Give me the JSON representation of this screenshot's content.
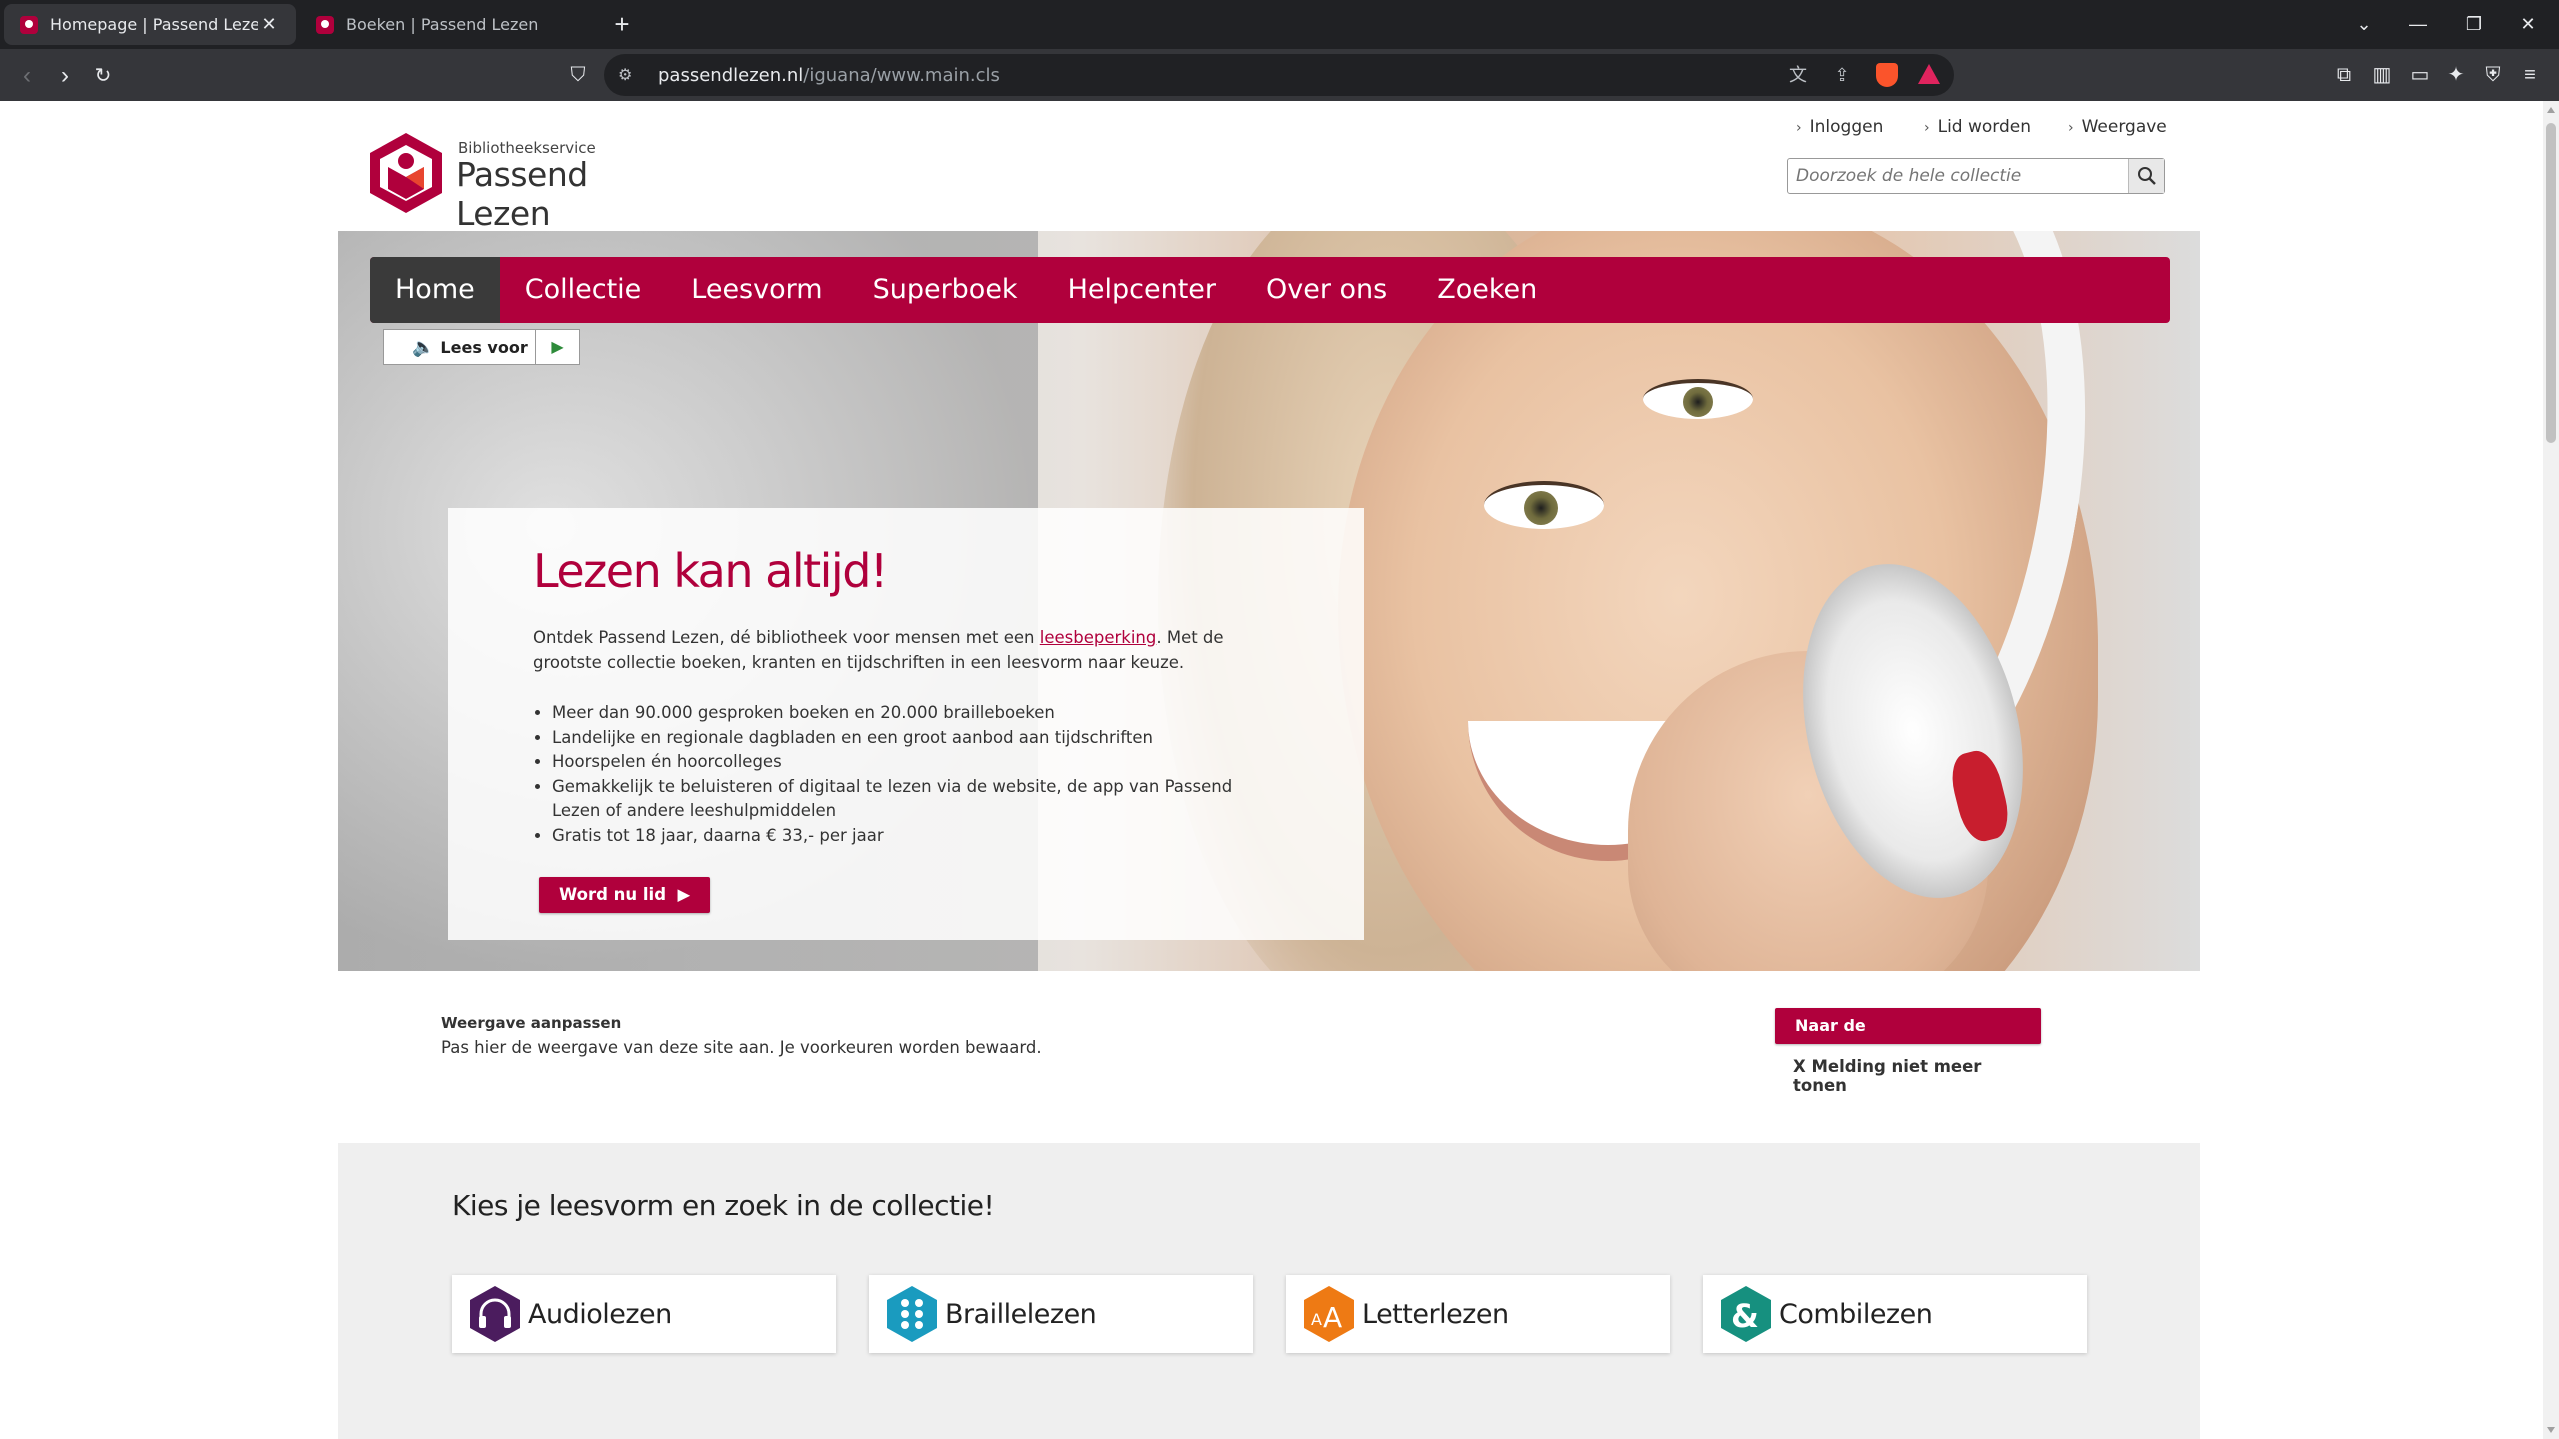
{
  "browser": {
    "tabs": [
      {
        "title": "Homepage | Passend Lezen",
        "active": true
      },
      {
        "title": "Boeken | Passend Lezen",
        "active": false
      }
    ],
    "url_domain": "passendlezen.nl",
    "url_path": "/iguana/www.main.cls"
  },
  "header": {
    "brand_small": "Bibliotheekservice",
    "brand": "Passend Lezen",
    "links": [
      "Inloggen",
      "Lid worden",
      "Weergave"
    ],
    "search_placeholder": "Doorzoek de hele collectie"
  },
  "nav": {
    "items": [
      "Home",
      "Collectie",
      "Leesvorm",
      "Superboek",
      "Helpcenter",
      "Over ons",
      "Zoeken"
    ],
    "active": "Home"
  },
  "read_aloud": {
    "label": "Lees voor"
  },
  "hero": {
    "title": "Lezen kan altijd!",
    "lead_before": "Ontdek Passend Lezen, dé bibliotheek voor mensen met een ",
    "lead_link": "leesbeperking",
    "lead_after": ". Met de grootste collectie boeken, kranten en tijdschriften in een leesvorm naar keuze.",
    "bullets": [
      "Meer dan 90.000 gesproken boeken en 20.000 brailleboeken",
      "Landelijke en regionale dagbladen en een groot aanbod aan tijdschriften",
      "Hoorspelen én hoorcolleges",
      "Gemakkelijk te beluisteren of digitaal te lezen via de website, de app van Passend Lezen of andere leeshulpmiddelen",
      "Gratis tot 18 jaar, daarna € 33,- per jaar"
    ],
    "cta": "Word nu lid"
  },
  "notice": {
    "title": "Weergave aanpassen",
    "description": "Pas hier de weergave van deze site aan. Je voorkeuren worden bewaard.",
    "button": "Naar de weergaveopties",
    "dismiss": "X Melding niet meer tonen"
  },
  "collection": {
    "heading": "Kies je leesvorm en zoek in de collectie!",
    "cards": [
      {
        "label": "Audiolezen",
        "icon": "headphones-icon",
        "color": "#4b1c5e"
      },
      {
        "label": "Braillelezen",
        "icon": "braille-icon",
        "color": "#1a9bbf"
      },
      {
        "label": "Letterlezen",
        "icon": "letter-size-icon",
        "color": "#ee7a14"
      },
      {
        "label": "Combilezen",
        "icon": "ampersand-icon",
        "color": "#16907f"
      }
    ]
  },
  "colors": {
    "brand": "#b0003c",
    "nav_active": "#3a3a3a"
  }
}
